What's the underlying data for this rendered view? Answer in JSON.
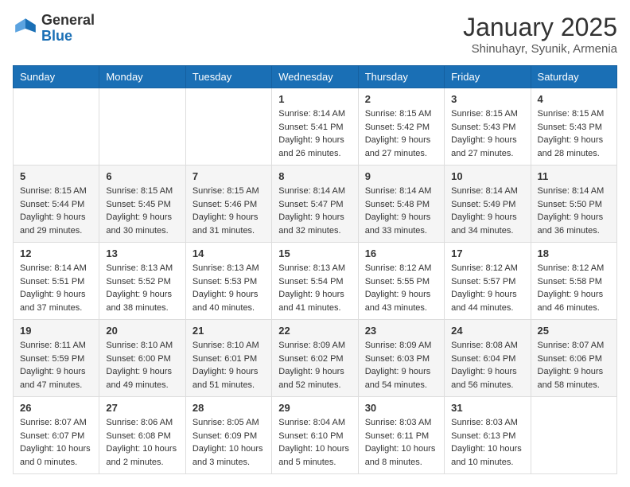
{
  "header": {
    "logo_general": "General",
    "logo_blue": "Blue",
    "month_title": "January 2025",
    "location": "Shinuhayr, Syunik, Armenia"
  },
  "calendar": {
    "days_of_week": [
      "Sunday",
      "Monday",
      "Tuesday",
      "Wednesday",
      "Thursday",
      "Friday",
      "Saturday"
    ],
    "weeks": [
      [
        {
          "day": "",
          "info": ""
        },
        {
          "day": "",
          "info": ""
        },
        {
          "day": "",
          "info": ""
        },
        {
          "day": "1",
          "info": "Sunrise: 8:14 AM\nSunset: 5:41 PM\nDaylight: 9 hours and 26 minutes."
        },
        {
          "day": "2",
          "info": "Sunrise: 8:15 AM\nSunset: 5:42 PM\nDaylight: 9 hours and 27 minutes."
        },
        {
          "day": "3",
          "info": "Sunrise: 8:15 AM\nSunset: 5:43 PM\nDaylight: 9 hours and 27 minutes."
        },
        {
          "day": "4",
          "info": "Sunrise: 8:15 AM\nSunset: 5:43 PM\nDaylight: 9 hours and 28 minutes."
        }
      ],
      [
        {
          "day": "5",
          "info": "Sunrise: 8:15 AM\nSunset: 5:44 PM\nDaylight: 9 hours and 29 minutes."
        },
        {
          "day": "6",
          "info": "Sunrise: 8:15 AM\nSunset: 5:45 PM\nDaylight: 9 hours and 30 minutes."
        },
        {
          "day": "7",
          "info": "Sunrise: 8:15 AM\nSunset: 5:46 PM\nDaylight: 9 hours and 31 minutes."
        },
        {
          "day": "8",
          "info": "Sunrise: 8:14 AM\nSunset: 5:47 PM\nDaylight: 9 hours and 32 minutes."
        },
        {
          "day": "9",
          "info": "Sunrise: 8:14 AM\nSunset: 5:48 PM\nDaylight: 9 hours and 33 minutes."
        },
        {
          "day": "10",
          "info": "Sunrise: 8:14 AM\nSunset: 5:49 PM\nDaylight: 9 hours and 34 minutes."
        },
        {
          "day": "11",
          "info": "Sunrise: 8:14 AM\nSunset: 5:50 PM\nDaylight: 9 hours and 36 minutes."
        }
      ],
      [
        {
          "day": "12",
          "info": "Sunrise: 8:14 AM\nSunset: 5:51 PM\nDaylight: 9 hours and 37 minutes."
        },
        {
          "day": "13",
          "info": "Sunrise: 8:13 AM\nSunset: 5:52 PM\nDaylight: 9 hours and 38 minutes."
        },
        {
          "day": "14",
          "info": "Sunrise: 8:13 AM\nSunset: 5:53 PM\nDaylight: 9 hours and 40 minutes."
        },
        {
          "day": "15",
          "info": "Sunrise: 8:13 AM\nSunset: 5:54 PM\nDaylight: 9 hours and 41 minutes."
        },
        {
          "day": "16",
          "info": "Sunrise: 8:12 AM\nSunset: 5:55 PM\nDaylight: 9 hours and 43 minutes."
        },
        {
          "day": "17",
          "info": "Sunrise: 8:12 AM\nSunset: 5:57 PM\nDaylight: 9 hours and 44 minutes."
        },
        {
          "day": "18",
          "info": "Sunrise: 8:12 AM\nSunset: 5:58 PM\nDaylight: 9 hours and 46 minutes."
        }
      ],
      [
        {
          "day": "19",
          "info": "Sunrise: 8:11 AM\nSunset: 5:59 PM\nDaylight: 9 hours and 47 minutes."
        },
        {
          "day": "20",
          "info": "Sunrise: 8:10 AM\nSunset: 6:00 PM\nDaylight: 9 hours and 49 minutes."
        },
        {
          "day": "21",
          "info": "Sunrise: 8:10 AM\nSunset: 6:01 PM\nDaylight: 9 hours and 51 minutes."
        },
        {
          "day": "22",
          "info": "Sunrise: 8:09 AM\nSunset: 6:02 PM\nDaylight: 9 hours and 52 minutes."
        },
        {
          "day": "23",
          "info": "Sunrise: 8:09 AM\nSunset: 6:03 PM\nDaylight: 9 hours and 54 minutes."
        },
        {
          "day": "24",
          "info": "Sunrise: 8:08 AM\nSunset: 6:04 PM\nDaylight: 9 hours and 56 minutes."
        },
        {
          "day": "25",
          "info": "Sunrise: 8:07 AM\nSunset: 6:06 PM\nDaylight: 9 hours and 58 minutes."
        }
      ],
      [
        {
          "day": "26",
          "info": "Sunrise: 8:07 AM\nSunset: 6:07 PM\nDaylight: 10 hours and 0 minutes."
        },
        {
          "day": "27",
          "info": "Sunrise: 8:06 AM\nSunset: 6:08 PM\nDaylight: 10 hours and 2 minutes."
        },
        {
          "day": "28",
          "info": "Sunrise: 8:05 AM\nSunset: 6:09 PM\nDaylight: 10 hours and 3 minutes."
        },
        {
          "day": "29",
          "info": "Sunrise: 8:04 AM\nSunset: 6:10 PM\nDaylight: 10 hours and 5 minutes."
        },
        {
          "day": "30",
          "info": "Sunrise: 8:03 AM\nSunset: 6:11 PM\nDaylight: 10 hours and 8 minutes."
        },
        {
          "day": "31",
          "info": "Sunrise: 8:03 AM\nSunset: 6:13 PM\nDaylight: 10 hours and 10 minutes."
        },
        {
          "day": "",
          "info": ""
        }
      ]
    ]
  }
}
